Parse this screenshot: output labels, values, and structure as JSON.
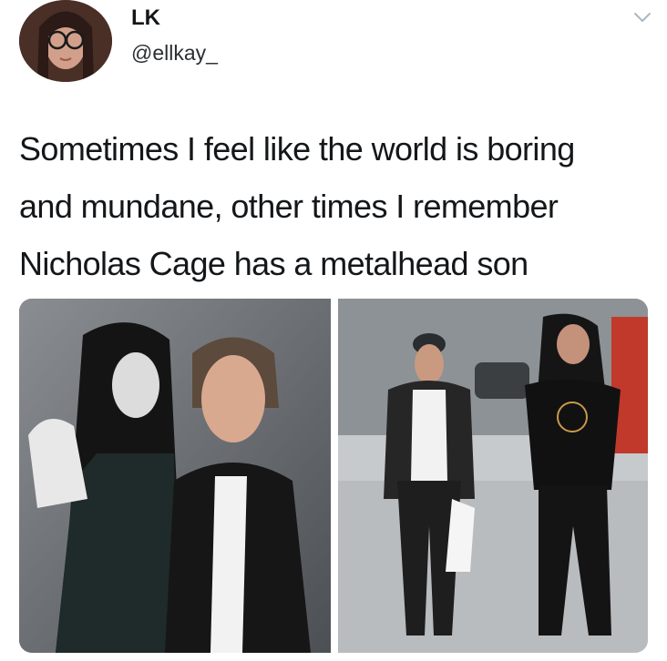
{
  "tweet": {
    "display_name": "LK",
    "handle": "@ellkay_",
    "text_lines": [
      "Sometimes I feel like the world is boring",
      "and mundane, other times I remember",
      "Nicholas Cage has a metalhead son"
    ]
  },
  "icons": {
    "menu": "chevron-down-icon",
    "avatar": "avatar-photo"
  },
  "colors": {
    "text": "#14171a",
    "handle": "#2b2f33",
    "chevron": "#aab8c2"
  }
}
